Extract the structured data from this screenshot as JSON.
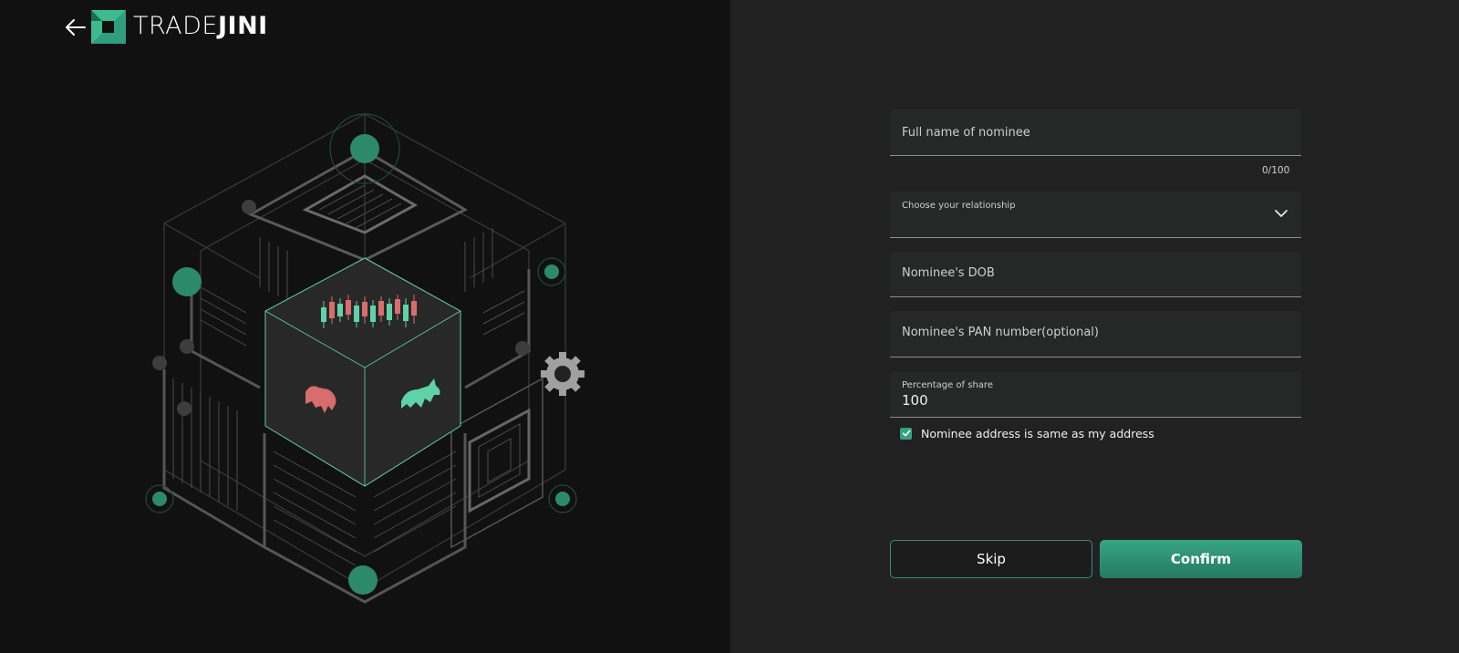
{
  "brand": {
    "name_light": "TRADE",
    "name_bold": "JINI",
    "accent_color": "#2f9e7b",
    "back_icon": "arrow-left-icon"
  },
  "form": {
    "full_name": {
      "placeholder": "Full name of nominee",
      "value": "",
      "counter": "0/100"
    },
    "relationship": {
      "label": "Choose your relationship",
      "value": "",
      "icon": "chevron-down-icon"
    },
    "dob": {
      "placeholder": "Nominee's DOB",
      "value": ""
    },
    "pan": {
      "placeholder": "Nominee's PAN number(optional)",
      "value": ""
    },
    "share": {
      "label": "Percentage of share",
      "value": "100"
    },
    "same_address": {
      "label": "Nominee address is same as my address",
      "checked": true
    }
  },
  "actions": {
    "skip_label": "Skip",
    "confirm_label": "Confirm"
  }
}
